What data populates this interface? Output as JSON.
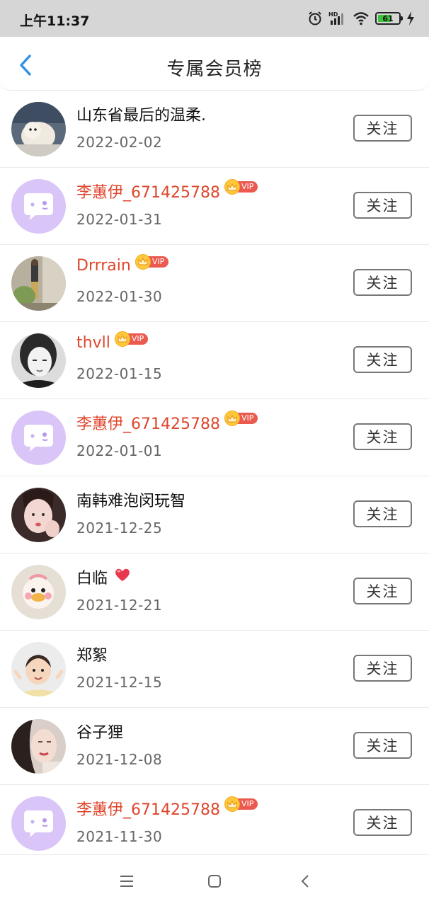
{
  "status": {
    "time": "上午11:37",
    "battery": "61",
    "icons": [
      "alarm-icon",
      "hd-signal-icon",
      "wifi-icon",
      "battery-icon",
      "charging-icon"
    ]
  },
  "header": {
    "title": "专属会员榜",
    "back_icon": "chevron-left-icon",
    "accent": "#2f8fe8"
  },
  "colors": {
    "vip_name": "#e0462c",
    "vip_badge": "#ea5a4f",
    "crown": "#ffc83a",
    "default_avatar": "#d9c5f7"
  },
  "vip_text": "VIP",
  "follow_label": "关注",
  "members": [
    {
      "name": "山东省最后的温柔.",
      "date": "2022-02-02",
      "vip": false,
      "avatar": "photo-dog"
    },
    {
      "name": "李蕙伊_671425788",
      "date": "2022-01-31",
      "vip": true,
      "avatar": "default-chat"
    },
    {
      "name": "Drrrain",
      "date": "2022-01-30",
      "vip": true,
      "avatar": "photo-room"
    },
    {
      "name": "thvll",
      "date": "2022-01-15",
      "vip": true,
      "avatar": "photo-girl-bw"
    },
    {
      "name": "李蕙伊_671425788",
      "date": "2022-01-01",
      "vip": true,
      "avatar": "default-chat"
    },
    {
      "name": "南韩难泡闵玩智",
      "date": "2021-12-25",
      "vip": false,
      "avatar": "photo-girl-pink"
    },
    {
      "name": "白临",
      "date": "2021-12-21",
      "vip": false,
      "avatar": "photo-duck",
      "heart": true
    },
    {
      "name": "郑絮",
      "date": "2021-12-15",
      "vip": false,
      "avatar": "photo-child"
    },
    {
      "name": "谷子狸",
      "date": "2021-12-08",
      "vip": false,
      "avatar": "photo-woman"
    },
    {
      "name": "李蕙伊_671425788",
      "date": "2021-11-30",
      "vip": true,
      "avatar": "default-chat"
    }
  ],
  "nav": {
    "icons": [
      "menu-icon",
      "home-square-icon",
      "back-triangle-icon"
    ]
  }
}
